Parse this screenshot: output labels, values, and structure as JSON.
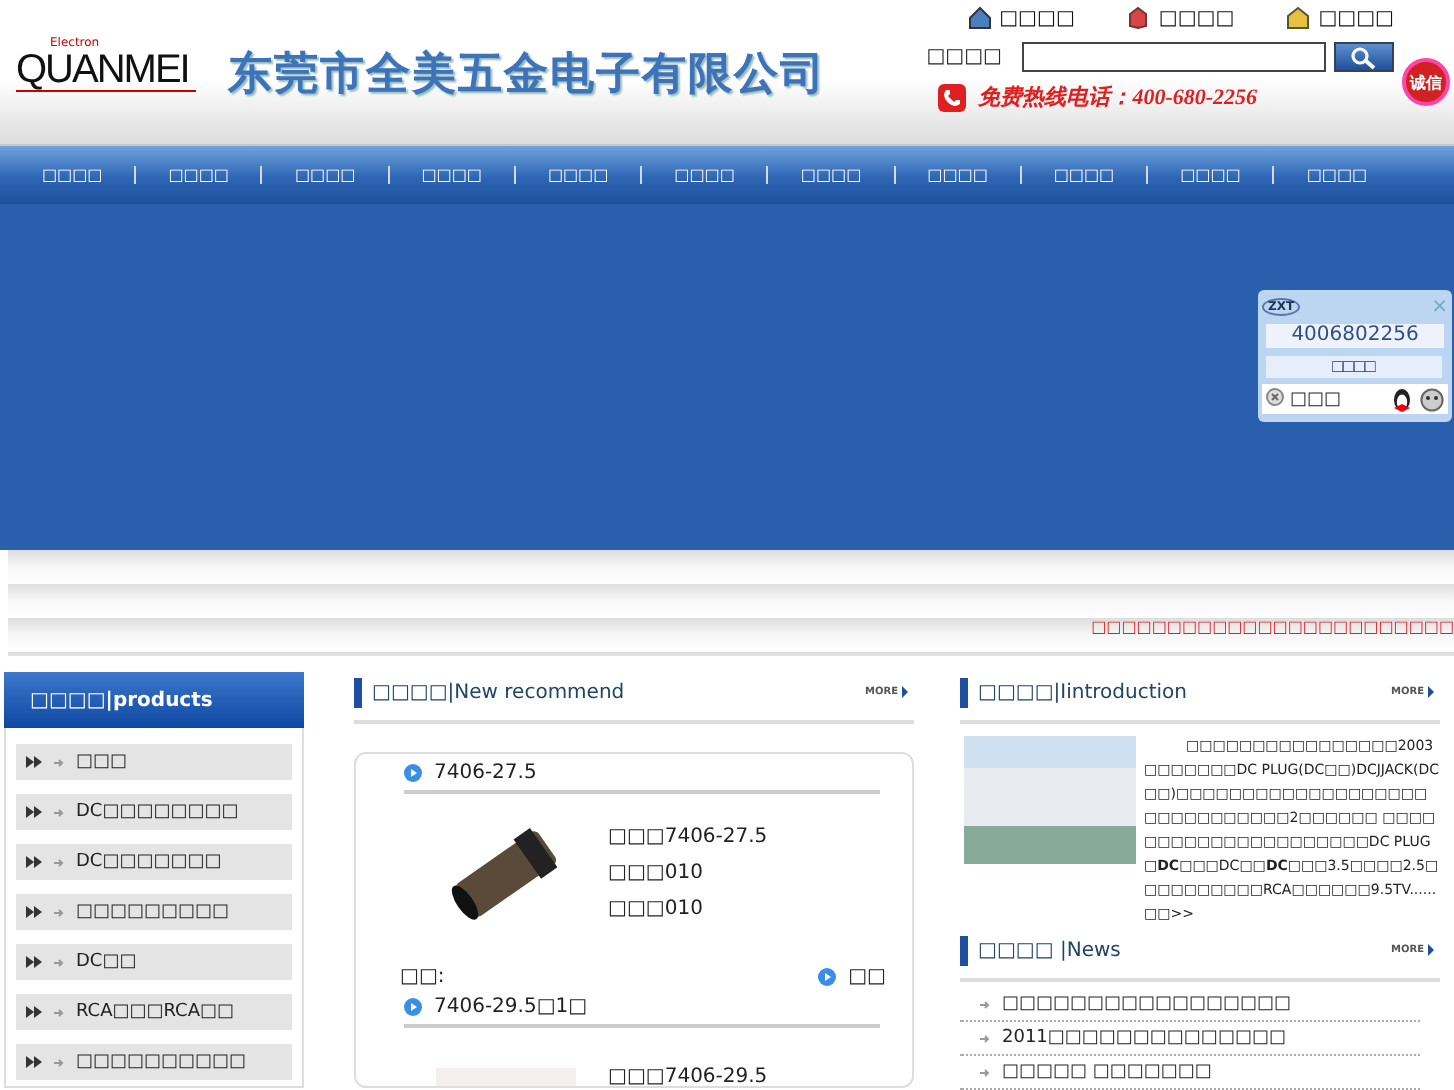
{
  "header": {
    "logo": {
      "brand": "QUANMEI",
      "tag": "Electron"
    },
    "company": "东莞市全美五金电子有限公司",
    "top_links": [
      {
        "label": "□□□□",
        "kind": "home"
      },
      {
        "label": "□□□□",
        "kind": "fav"
      },
      {
        "label": "□□□□",
        "kind": "contact"
      }
    ],
    "search": {
      "label": "□□□□"
    },
    "hotline": "免费热线电话：400-680-2256",
    "badge": "诚信"
  },
  "nav": [
    "□□□□",
    "□□□□",
    "□□□□",
    "□□□□",
    "□□□□",
    "□□□□",
    "□□□□",
    "□□□□",
    "□□□□",
    "□□□□",
    "□□□□"
  ],
  "chat_widget": {
    "brand": "ZXT",
    "close": "×",
    "phone": "4006802256",
    "button": "□□□□",
    "agent": "□□□"
  },
  "marquee": "□□□□□□□□□□□□□□□□□□□□□□□□",
  "products": {
    "title": "□□□□|products",
    "items": [
      "□□□",
      "DC□□□□□□□□",
      "DC□□□□□□□",
      "□□□□□□□□□",
      "DC□□",
      "RCA□□□RCA□□",
      "□□□□□□□□□□"
    ]
  },
  "recommend": {
    "title": "□□□□|New recommend",
    "more": "MORE",
    "items": [
      {
        "name": "7406-27.5",
        "lines": [
          "□□□7406-27.5",
          "□□□010",
          "□□□010"
        ],
        "footer_left": "□□:",
        "footer_right": "□□"
      },
      {
        "name": "7406-29.5□1□",
        "lines": [
          "□□□7406-29.5"
        ]
      }
    ]
  },
  "introduction": {
    "title": "□□□□|Iintroduction",
    "more": "MORE",
    "text": "□□□□□□□□□□□□□□□□2003□□□□□□□DC PLUG(DC□□)DCJJACK(DC□□)□□□□□□□□□□□□□□□□□□□□□□□□□□□□□□2□□□□□□  □□□□□□□□□□□□□□□□□□□□□DC PLUG□**DC**□□□DC□□**DC**□□□3.5□□□□2.5□□□□□□□□□□RCA□□□□□□9.5TV......□□>>"
  },
  "news": {
    "title": "□□□□ |News",
    "more": "MORE",
    "items": [
      "□□□□□□□□□□□□□□□□□",
      "2011□□□□□□□□□□□□□□",
      "□□□□□ □□□□□□□"
    ]
  }
}
